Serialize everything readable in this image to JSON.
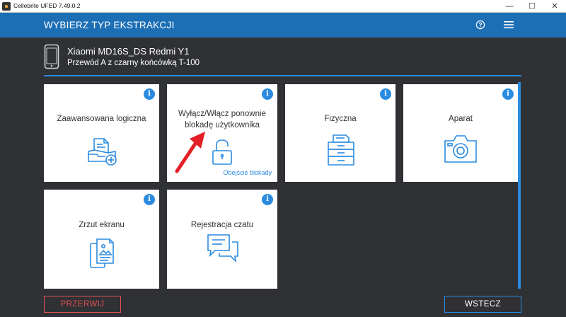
{
  "window": {
    "title": "Cellebrite UFED 7.49.0.2",
    "minimize": "—",
    "maximize": "☐",
    "close": "✕"
  },
  "header": {
    "title": "WYBIERZ TYP EKSTRAKCJI",
    "help_icon": "question-circle-icon",
    "menu_icon": "hamburger-menu-icon"
  },
  "device": {
    "name": "Xiaomi MD16S_DS Redmi Y1",
    "cable": "Przewód A z czarny końcówką T-100",
    "icon": "phone-icon"
  },
  "tiles": [
    {
      "id": "advanced-logical",
      "label": "Zaawansowana logiczna",
      "icon": "document-plus-tray-icon"
    },
    {
      "id": "lock-bypass",
      "label_line1": "Wyłącz/Włącz ponownie",
      "label_line2": "blokadę użytkownika",
      "link": "Obejście blokady",
      "icon": "padlock-open-icon"
    },
    {
      "id": "physical",
      "label": "Fizyczna",
      "icon": "printer-tray-icon"
    },
    {
      "id": "camera",
      "label": "Aparat",
      "icon": "camera-icon"
    },
    {
      "id": "screenshot",
      "label": "Zrzut ekranu",
      "icon": "screenshot-document-icon"
    },
    {
      "id": "chat-capture",
      "label": "Rejestracja czatu",
      "icon": "chat-bubbles-icon"
    }
  ],
  "info_glyph": "i",
  "footer": {
    "abort": "PRZERWIJ",
    "back": "WSTECZ"
  },
  "colors": {
    "header_blue": "#1d6fb5",
    "accent_blue": "#2a8be0",
    "background": "#2f3135",
    "abort_red": "#e05050",
    "annotation_arrow": "#e31e24"
  }
}
